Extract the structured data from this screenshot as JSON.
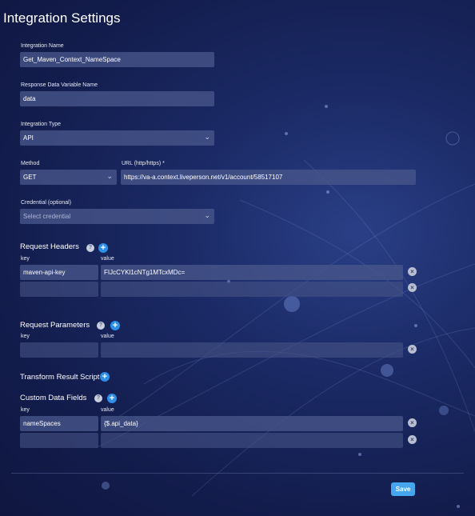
{
  "title": "Integration Settings",
  "integration_name": {
    "label": "Integration Name",
    "value": "Get_Maven_Context_NameSpace"
  },
  "response_var": {
    "label": "Response Data Variable Name",
    "value": "data"
  },
  "integration_type": {
    "label": "Integration Type",
    "value": "API"
  },
  "method": {
    "label": "Method",
    "value": "GET"
  },
  "url": {
    "label": "URL (http/https) *",
    "value": "https://va-a.context.liveperson.net/v1/account/58517107"
  },
  "credential": {
    "label": "Credential (optional)",
    "placeholder": "Select credential"
  },
  "request_headers": {
    "title": "Request Headers",
    "key_label": "key",
    "value_label": "value",
    "rows": [
      {
        "key": "maven-api-key",
        "value": "FIJcCYKl1cNTg1MTcxMDc="
      },
      {
        "key": "",
        "value": ""
      }
    ]
  },
  "request_parameters": {
    "title": "Request Parameters",
    "key_label": "key",
    "value_label": "value",
    "rows": [
      {
        "key": "",
        "value": ""
      }
    ]
  },
  "transform_script": {
    "title": "Transform Result Script"
  },
  "custom_fields": {
    "title": "Custom Data Fields",
    "key_label": "key",
    "value_label": "value",
    "rows": [
      {
        "key": "nameSpaces",
        "value": "{$.api_data}"
      },
      {
        "key": "",
        "value": ""
      }
    ]
  },
  "icons": {
    "help": "help-circle-icon",
    "add": "plus-circle-icon",
    "delete": "close-circle-icon",
    "dropdown": "chevron-down-icon"
  },
  "colors": {
    "accent": "#2e8fe8",
    "save": "#45a6ef",
    "field": "#48568a"
  },
  "save_label": "Save"
}
